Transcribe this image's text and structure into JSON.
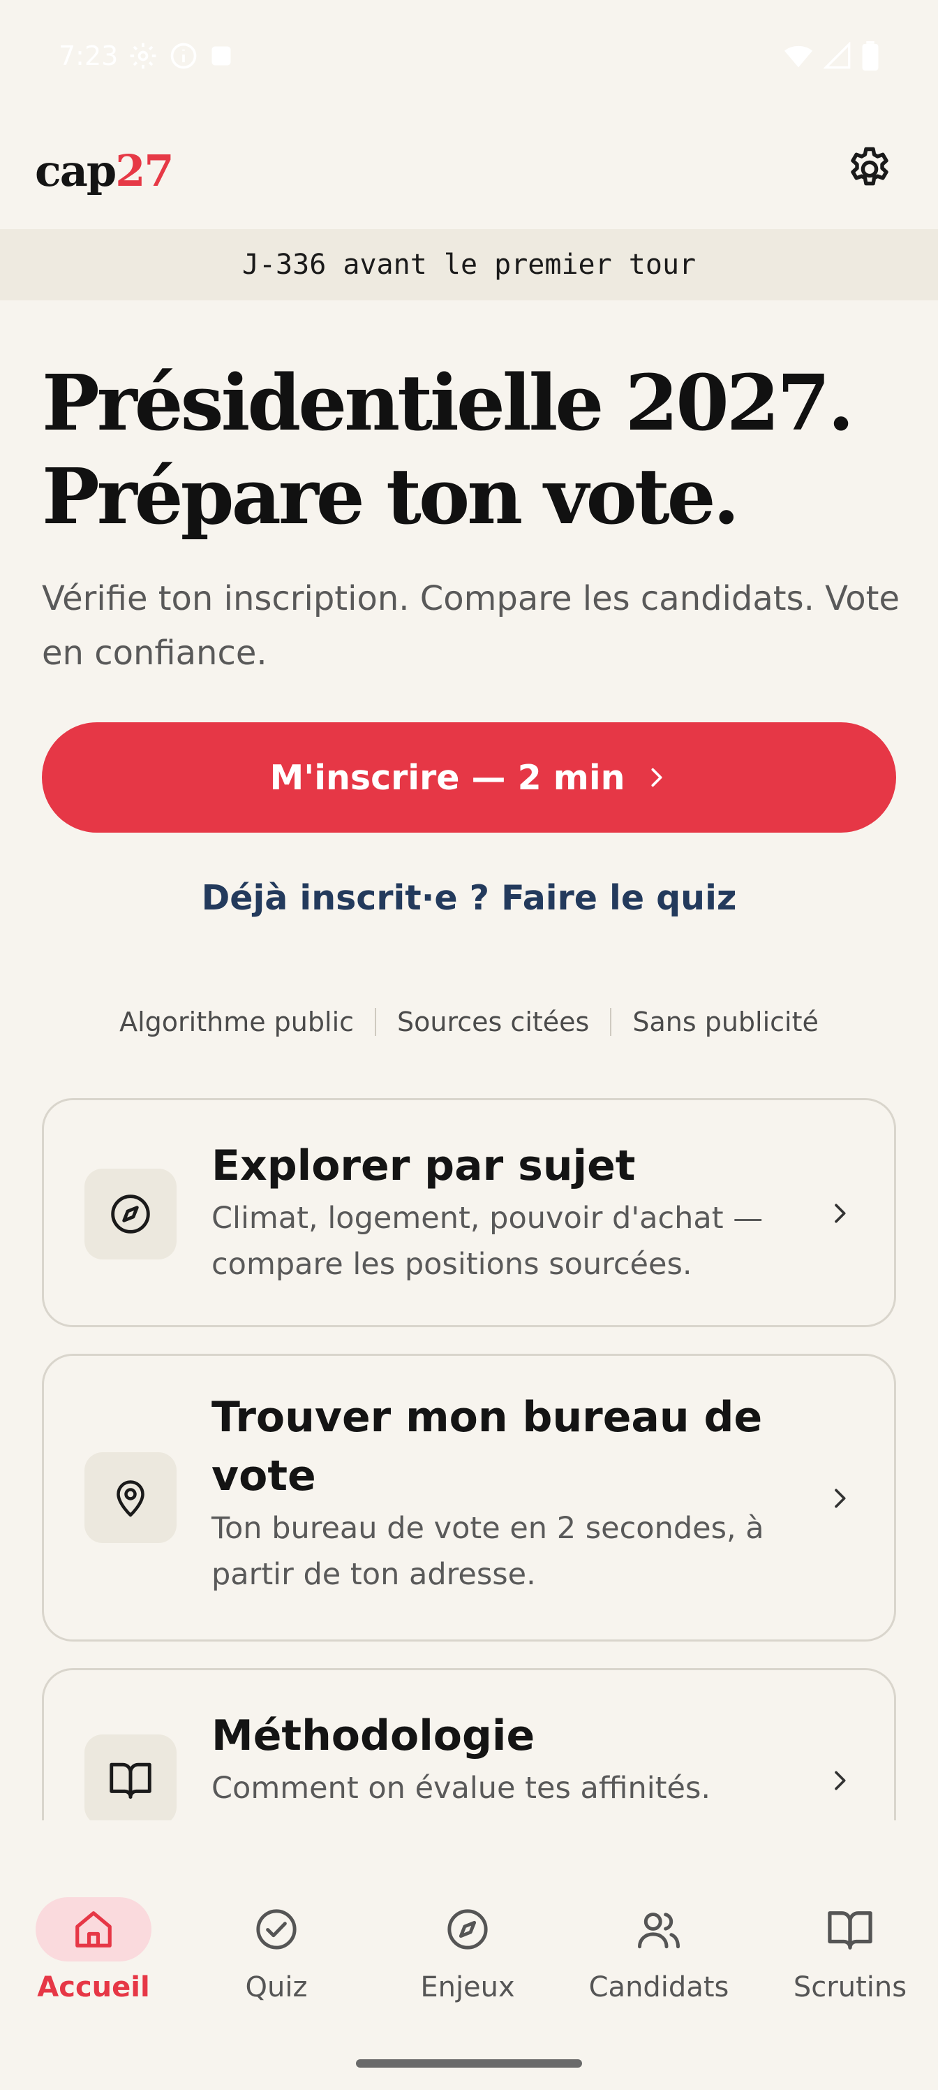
{
  "status_bar": {
    "time": "7:23"
  },
  "header": {
    "logo_text": "cap",
    "logo_number": "27",
    "settings_icon": "gear-icon"
  },
  "countdown": {
    "text": "J-336 avant le premier tour"
  },
  "hero": {
    "title_line1": "Présidentielle 2027.",
    "title_line2": "Prépare ton vote.",
    "subtitle": "Vérifie ton inscription. Compare les candidats. Vote en confiance."
  },
  "actions": {
    "primary_label": "M'inscrire — 2 min",
    "secondary_label": "Déjà inscrit·e ? Faire le quiz"
  },
  "trust": [
    "Algorithme public",
    "Sources citées",
    "Sans publicité"
  ],
  "cards": [
    {
      "icon": "compass-icon",
      "title": "Explorer par sujet",
      "description": "Climat, logement, pouvoir d'achat — compare les positions sourcées."
    },
    {
      "icon": "location-pin-icon",
      "title": "Trouver mon bureau de vote",
      "description": "Ton bureau de vote en 2 secondes, à partir de ton adresse."
    },
    {
      "icon": "book-icon",
      "title": "Méthodologie",
      "description": "Comment on évalue tes affinités."
    }
  ],
  "nav": [
    {
      "label": "Accueil",
      "icon": "home-icon",
      "active": true
    },
    {
      "label": "Quiz",
      "icon": "check-circle-icon",
      "active": false
    },
    {
      "label": "Enjeux",
      "icon": "compass-icon",
      "active": false
    },
    {
      "label": "Candidats",
      "icon": "users-icon",
      "active": false
    },
    {
      "label": "Scrutins",
      "icon": "book-icon",
      "active": false
    }
  ],
  "colors": {
    "accent": "#e63746",
    "background": "#f7f4ee",
    "link": "#233a5c"
  }
}
